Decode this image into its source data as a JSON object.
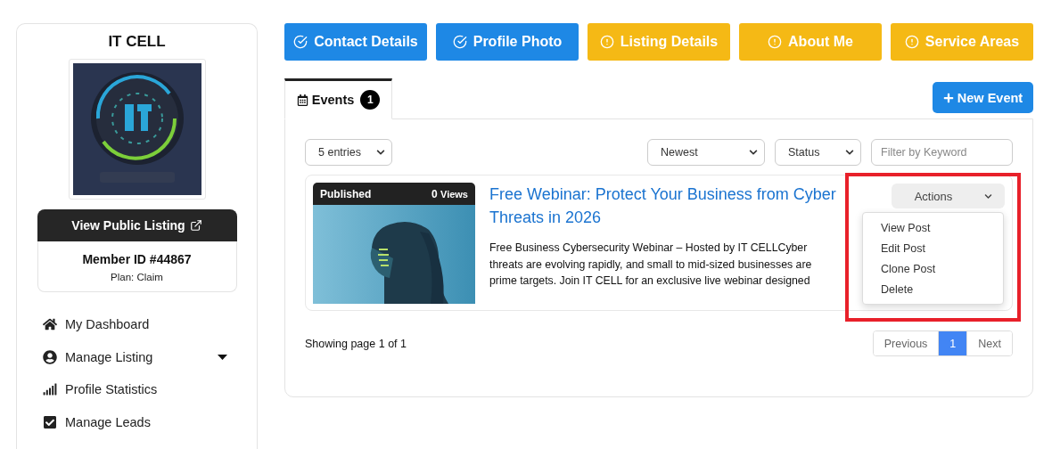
{
  "sidebar": {
    "title": "IT CELL",
    "logo": {
      "kind": "picture"
    },
    "public_link": "View Public Listing",
    "member_id": "Member ID #44867",
    "plan": "Plan: Claim",
    "menu": [
      {
        "label": "My Dashboard",
        "has_submenu": false
      },
      {
        "label": "Manage Listing",
        "has_submenu": true
      },
      {
        "label": "Profile Statistics",
        "has_submenu": false
      },
      {
        "label": "Manage Leads",
        "has_submenu": false
      }
    ]
  },
  "steps": [
    {
      "label": "Contact Details",
      "complete": true
    },
    {
      "label": "Profile Photo",
      "complete": true
    },
    {
      "label": "Listing Details",
      "complete": false
    },
    {
      "label": "About Me",
      "complete": false
    },
    {
      "label": "Service Areas",
      "complete": false
    }
  ],
  "tabs": [
    {
      "label": "Events",
      "count": "1",
      "selected": true
    }
  ],
  "new_button": "New Event",
  "filters": {
    "entries": "5 entries",
    "sort": "Newest",
    "status": "Status",
    "keyword_placeholder": "Filter by Keyword"
  },
  "events": [
    {
      "status": "Published",
      "views_count": "0",
      "views_label": "Views",
      "image": {
        "kind": "picture"
      },
      "title": "Free Webinar: Protect Your Business from Cyber Threats in 2026",
      "description": "Free Business Cybersecurity Webinar – Hosted by IT CELLCyber threats are evolving rapidly, and small to mid-sized businesses are prime targets. Join IT CELL for an exclusive live webinar designed",
      "actions_label": "Actions",
      "menu_open": true,
      "menu": [
        "View Post",
        "Edit Post",
        "Clone Post",
        "Delete"
      ],
      "highlighted": true
    }
  ],
  "footer": {
    "summary": "Showing page 1 of 1",
    "pages": [
      {
        "label": "Previous",
        "selected": false
      },
      {
        "label": "1",
        "selected": true
      },
      {
        "label": "Next",
        "selected": false
      }
    ]
  }
}
